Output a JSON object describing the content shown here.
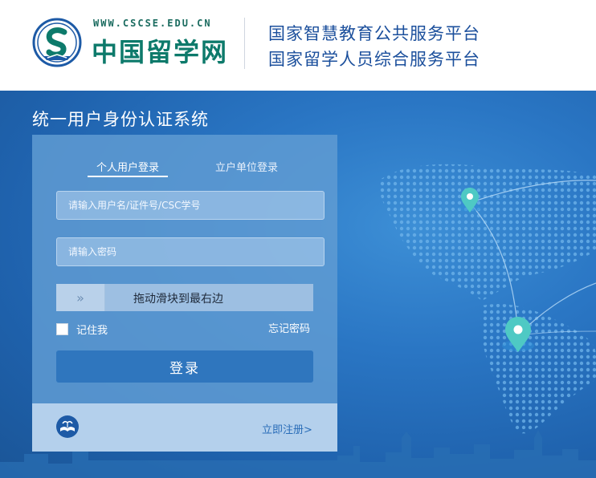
{
  "header": {
    "logo_url": "WWW.CSCSE.EDU.CN",
    "logo_name": "中国留学网",
    "slogan_line1": "国家智慧教育公共服务平台",
    "slogan_line2": "国家留学人员综合服务平台",
    "logo_icon": "cscse-emblem-icon"
  },
  "main": {
    "system_title": "统一用户身份认证系统"
  },
  "login": {
    "tabs": [
      {
        "label": "个人用户登录",
        "active": true
      },
      {
        "label": "立户单位登录",
        "active": false
      }
    ],
    "username_placeholder": "请输入用户名/证件号/CSC学号",
    "username_value": "",
    "password_placeholder": "请输入密码",
    "password_value": "",
    "slider_handle_glyph": "»",
    "slider_text": "拖动滑块到最右边",
    "remember_label": "记住我",
    "remember_checked": false,
    "forgot_label": "忘记密码",
    "submit_label": "登录",
    "footer_icon": "book-emblem-icon",
    "register_label": "立即注册>"
  },
  "colors": {
    "brand_green": "#0d7a6b",
    "slogan_blue": "#1b4f9c",
    "button_blue": "#2f76be",
    "link_blue": "#2a6db8"
  }
}
